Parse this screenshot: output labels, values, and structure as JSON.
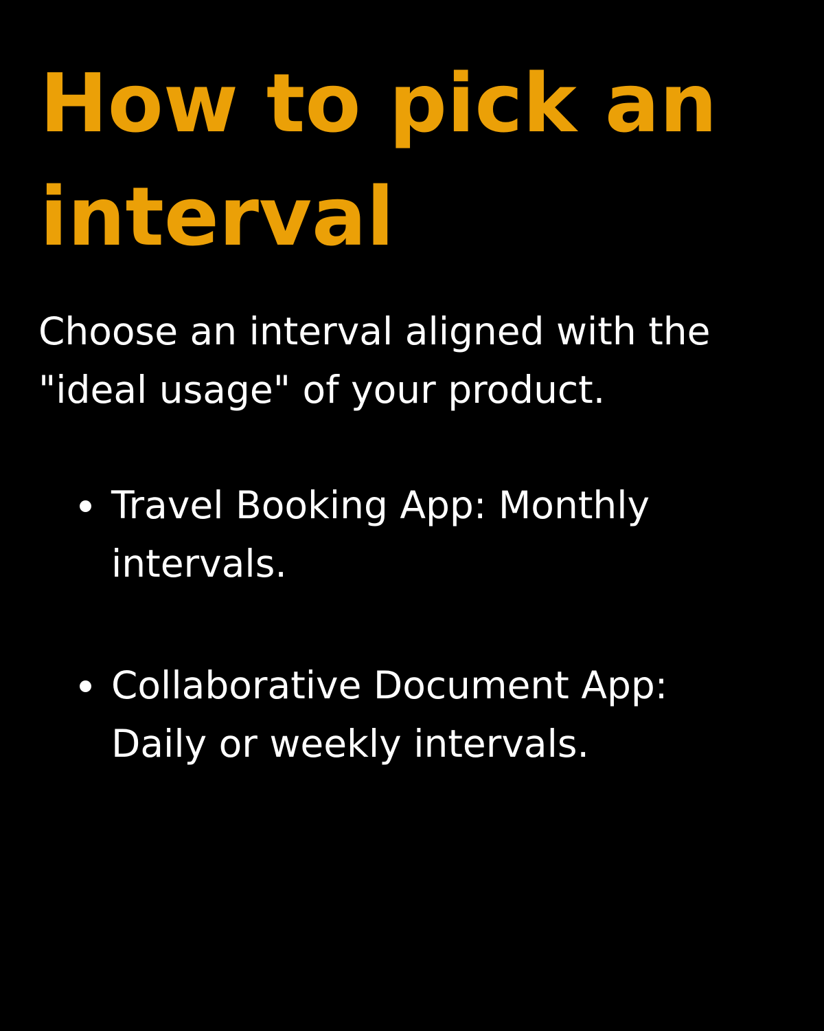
{
  "colors": {
    "background": "#000000",
    "title": "#EBA007",
    "text": "#FFFFFF"
  },
  "title": "How to pick an interval",
  "intro": "Choose an interval aligned with the \"ideal usage\" of your product.",
  "bullets": [
    {
      "text": "Travel Booking App: Monthly intervals."
    },
    {
      "text": "Collaborative Document App: Daily or weekly intervals."
    }
  ]
}
